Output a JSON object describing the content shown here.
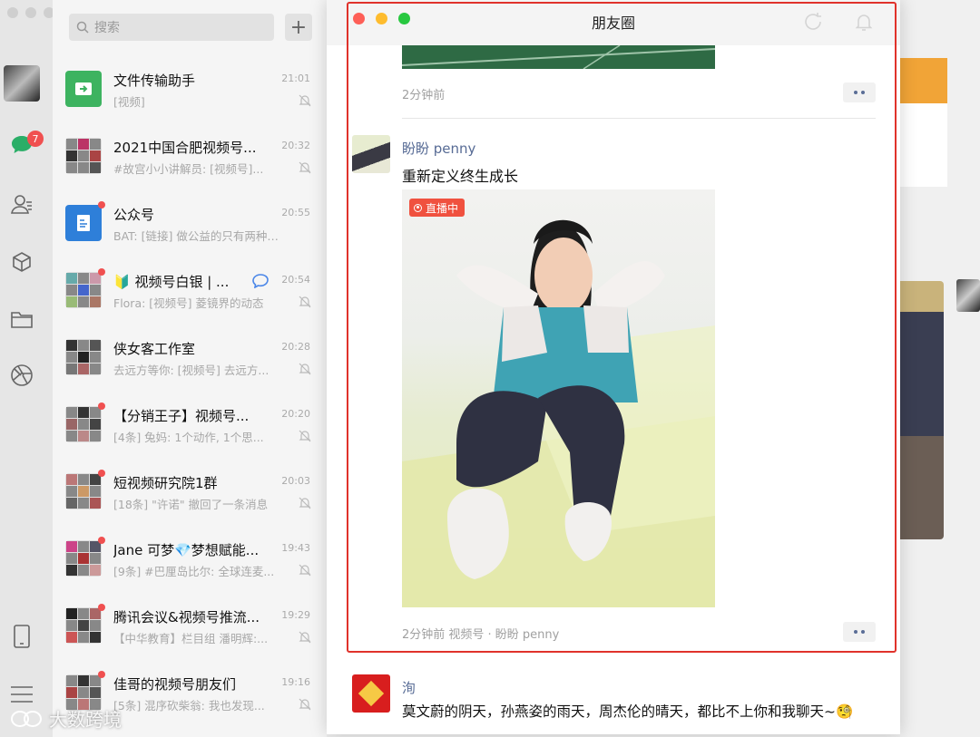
{
  "sidebar": {
    "unread_badge": "7"
  },
  "search": {
    "placeholder": "搜索"
  },
  "chats": [
    {
      "name": "文件传输助手",
      "time": "21:01",
      "preview": "[视频]"
    },
    {
      "name": "2021中国合肥视频号...",
      "time": "20:32",
      "preview": "#故宫小小讲解员: [视频号]..."
    },
    {
      "name": "公众号",
      "time": "20:55",
      "preview": "BAT: [链接] 做公益的只有两种公..."
    },
    {
      "name": "🔰 视频号白银 | ...",
      "time": "20:54",
      "preview": "Flora: [视频号] 菱镜界的动态"
    },
    {
      "name": "侠女客工作室",
      "time": "20:28",
      "preview": "去远方等你: [视频号] 去远方..."
    },
    {
      "name": "【分销王子】视频号...",
      "time": "20:20",
      "preview": "[4条] 兔妈: 1个动作, 1个思..."
    },
    {
      "name": "短视频研究院1群",
      "time": "20:03",
      "preview": "[18条] \"许诺\" 撤回了一条消息"
    },
    {
      "name": "Jane 可梦💎梦想赋能...",
      "time": "19:43",
      "preview": "[9条] #巴厘岛比尔: 全球连麦..."
    },
    {
      "name": "腾讯会议&视频号推流...",
      "time": "19:29",
      "preview": "【中华教育】栏目组 潘明辉:..."
    },
    {
      "name": "佳哥的视频号朋友们",
      "time": "19:16",
      "preview": "[5条] 混序砍柴翁: 我也发现..."
    }
  ],
  "moments": {
    "title": "朋友圈",
    "prev_post_time": "2分钟前",
    "post": {
      "author": "盼盼 penny",
      "text": "重新定义终生成长",
      "live_label": "直播中",
      "footer": "2分钟前  视频号 · 盼盼 penny"
    },
    "next_post": {
      "author": "洵",
      "text": "莫文蔚的阴天，孙燕姿的雨天，周杰伦的晴天，都比不上你和我聊天~🧐"
    }
  },
  "watermark": "大数跨境",
  "colors": {
    "accent_red": "#e0322b",
    "name_blue": "#576b95",
    "live_red": "#f0513f",
    "badge_red": "#f05050"
  }
}
